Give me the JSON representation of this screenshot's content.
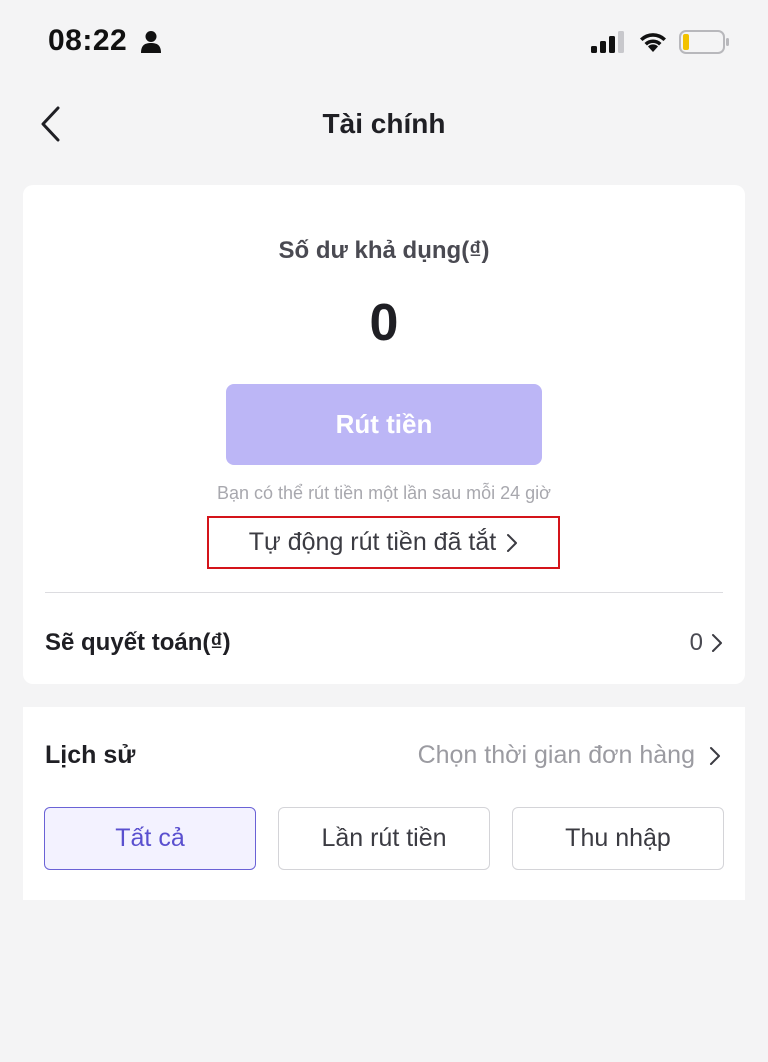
{
  "status_bar": {
    "time": "08:22"
  },
  "header": {
    "title": "Tài chính"
  },
  "balance": {
    "label": "Số dư khả dụng(₫)",
    "value": "0",
    "withdraw_button": "Rút tiền",
    "note": "Bạn có thể rút tiền một lần sau mỗi 24 giờ",
    "auto_withdraw": "Tự động rút tiền đã tắt"
  },
  "settlement": {
    "label": "Sẽ quyết toán(₫)",
    "value": "0"
  },
  "history": {
    "label": "Lịch sử",
    "time_filter": "Chọn thời gian đơn hàng",
    "tabs": [
      {
        "label": "Tất cả",
        "active": true
      },
      {
        "label": "Lần rút tiền",
        "active": false
      },
      {
        "label": "Thu nhập",
        "active": false
      }
    ]
  },
  "colors": {
    "accent": "#5a50cf",
    "button_disabled": "#bcb6f6",
    "highlight_box": "#d4141a",
    "background": "#f4f4f5"
  }
}
